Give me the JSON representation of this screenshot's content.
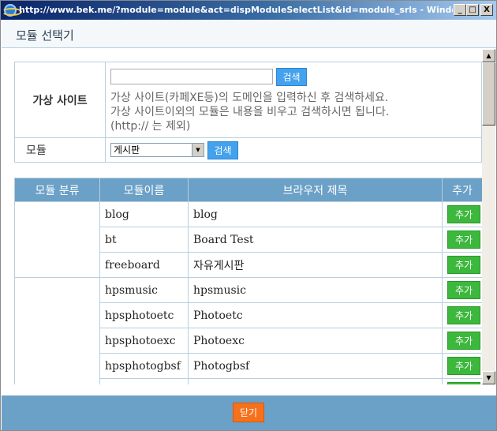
{
  "window": {
    "title": "http://www.bek.me/?module=module&act=dispModuleSelectList&id=module_srls - Windows I...",
    "min": "_",
    "max": "□",
    "close": "X"
  },
  "header": {
    "title": "모듈 선택기"
  },
  "form": {
    "virtual_site_label": "가상 사이트",
    "search_label": "검색",
    "help_line1": "가상 사이트(카페XE등)의 도메인을 입력하신 후 검색하세요.",
    "help_line2": "가상 사이트이외의 모듈은 내용을 비우고 검색하시면 됩니다.",
    "help_line3": "(http:// 는 제외)",
    "module_label": "모듈",
    "module_selected": "게시판",
    "module_search_label": "검색"
  },
  "table": {
    "headers": [
      "모듈 분류",
      "모듈이름",
      "브라우저 제목",
      "추가"
    ],
    "add_label": "추가",
    "rows": [
      {
        "name": "blog",
        "title": "blog"
      },
      {
        "name": "bt",
        "title": "Board Test"
      },
      {
        "name": "freeboard",
        "title": "자유게시판"
      },
      {
        "name": "hpsmusic",
        "title": "hpsmusic"
      },
      {
        "name": "hpsphotoetc",
        "title": "Photoetc"
      },
      {
        "name": "hpsphotoexc",
        "title": "Photoexc"
      },
      {
        "name": "hpsphotogbsf",
        "title": "Photogbsf"
      }
    ]
  },
  "footer": {
    "close_label": "닫기"
  }
}
